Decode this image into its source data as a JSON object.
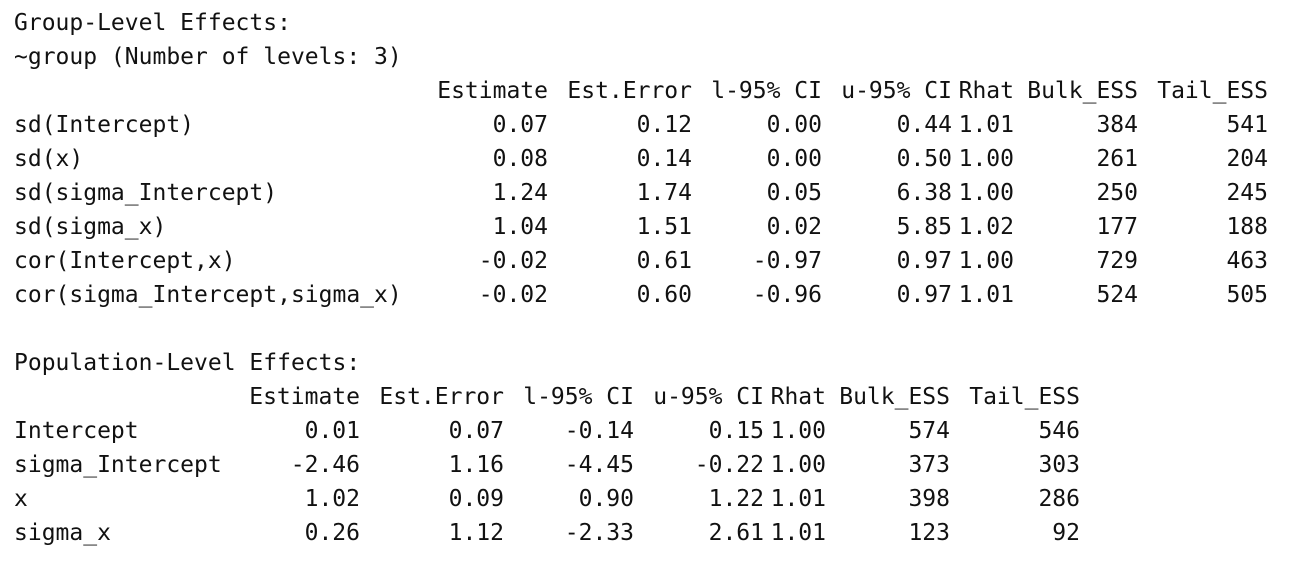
{
  "group": {
    "title": "Group-Level Effects:",
    "subtitle": "~group (Number of levels: 3)",
    "headers": [
      "Estimate",
      "Est.Error",
      "l-95% CI",
      "u-95% CI",
      "Rhat",
      "Bulk_ESS",
      "Tail_ESS"
    ],
    "rows": [
      {
        "name": "sd(Intercept)",
        "cells": [
          "0.07",
          "0.12",
          "0.00",
          "0.44",
          "1.01",
          "384",
          "541"
        ]
      },
      {
        "name": "sd(x)",
        "cells": [
          "0.08",
          "0.14",
          "0.00",
          "0.50",
          "1.00",
          "261",
          "204"
        ]
      },
      {
        "name": "sd(sigma_Intercept)",
        "cells": [
          "1.24",
          "1.74",
          "0.05",
          "6.38",
          "1.00",
          "250",
          "245"
        ]
      },
      {
        "name": "sd(sigma_x)",
        "cells": [
          "1.04",
          "1.51",
          "0.02",
          "5.85",
          "1.02",
          "177",
          "188"
        ]
      },
      {
        "name": "cor(Intercept,x)",
        "cells": [
          "-0.02",
          "0.61",
          "-0.97",
          "0.97",
          "1.00",
          "729",
          "463"
        ]
      },
      {
        "name": "cor(sigma_Intercept,sigma_x)",
        "cells": [
          "-0.02",
          "0.60",
          "-0.96",
          "0.97",
          "1.01",
          "524",
          "505"
        ]
      }
    ]
  },
  "population": {
    "title": "Population-Level Effects:",
    "headers": [
      "Estimate",
      "Est.Error",
      "l-95% CI",
      "u-95% CI",
      "Rhat",
      "Bulk_ESS",
      "Tail_ESS"
    ],
    "rows": [
      {
        "name": "Intercept",
        "cells": [
          "0.01",
          "0.07",
          "-0.14",
          "0.15",
          "1.00",
          "574",
          "546"
        ]
      },
      {
        "name": "sigma_Intercept",
        "cells": [
          "-2.46",
          "1.16",
          "-4.45",
          "-0.22",
          "1.00",
          "373",
          "303"
        ]
      },
      {
        "name": "x",
        "cells": [
          "1.02",
          "0.09",
          "0.90",
          "1.22",
          "1.01",
          "398",
          "286"
        ]
      },
      {
        "name": "sigma_x",
        "cells": [
          "0.26",
          "1.12",
          "-2.33",
          "2.61",
          "1.01",
          "123",
          "92"
        ]
      }
    ]
  }
}
